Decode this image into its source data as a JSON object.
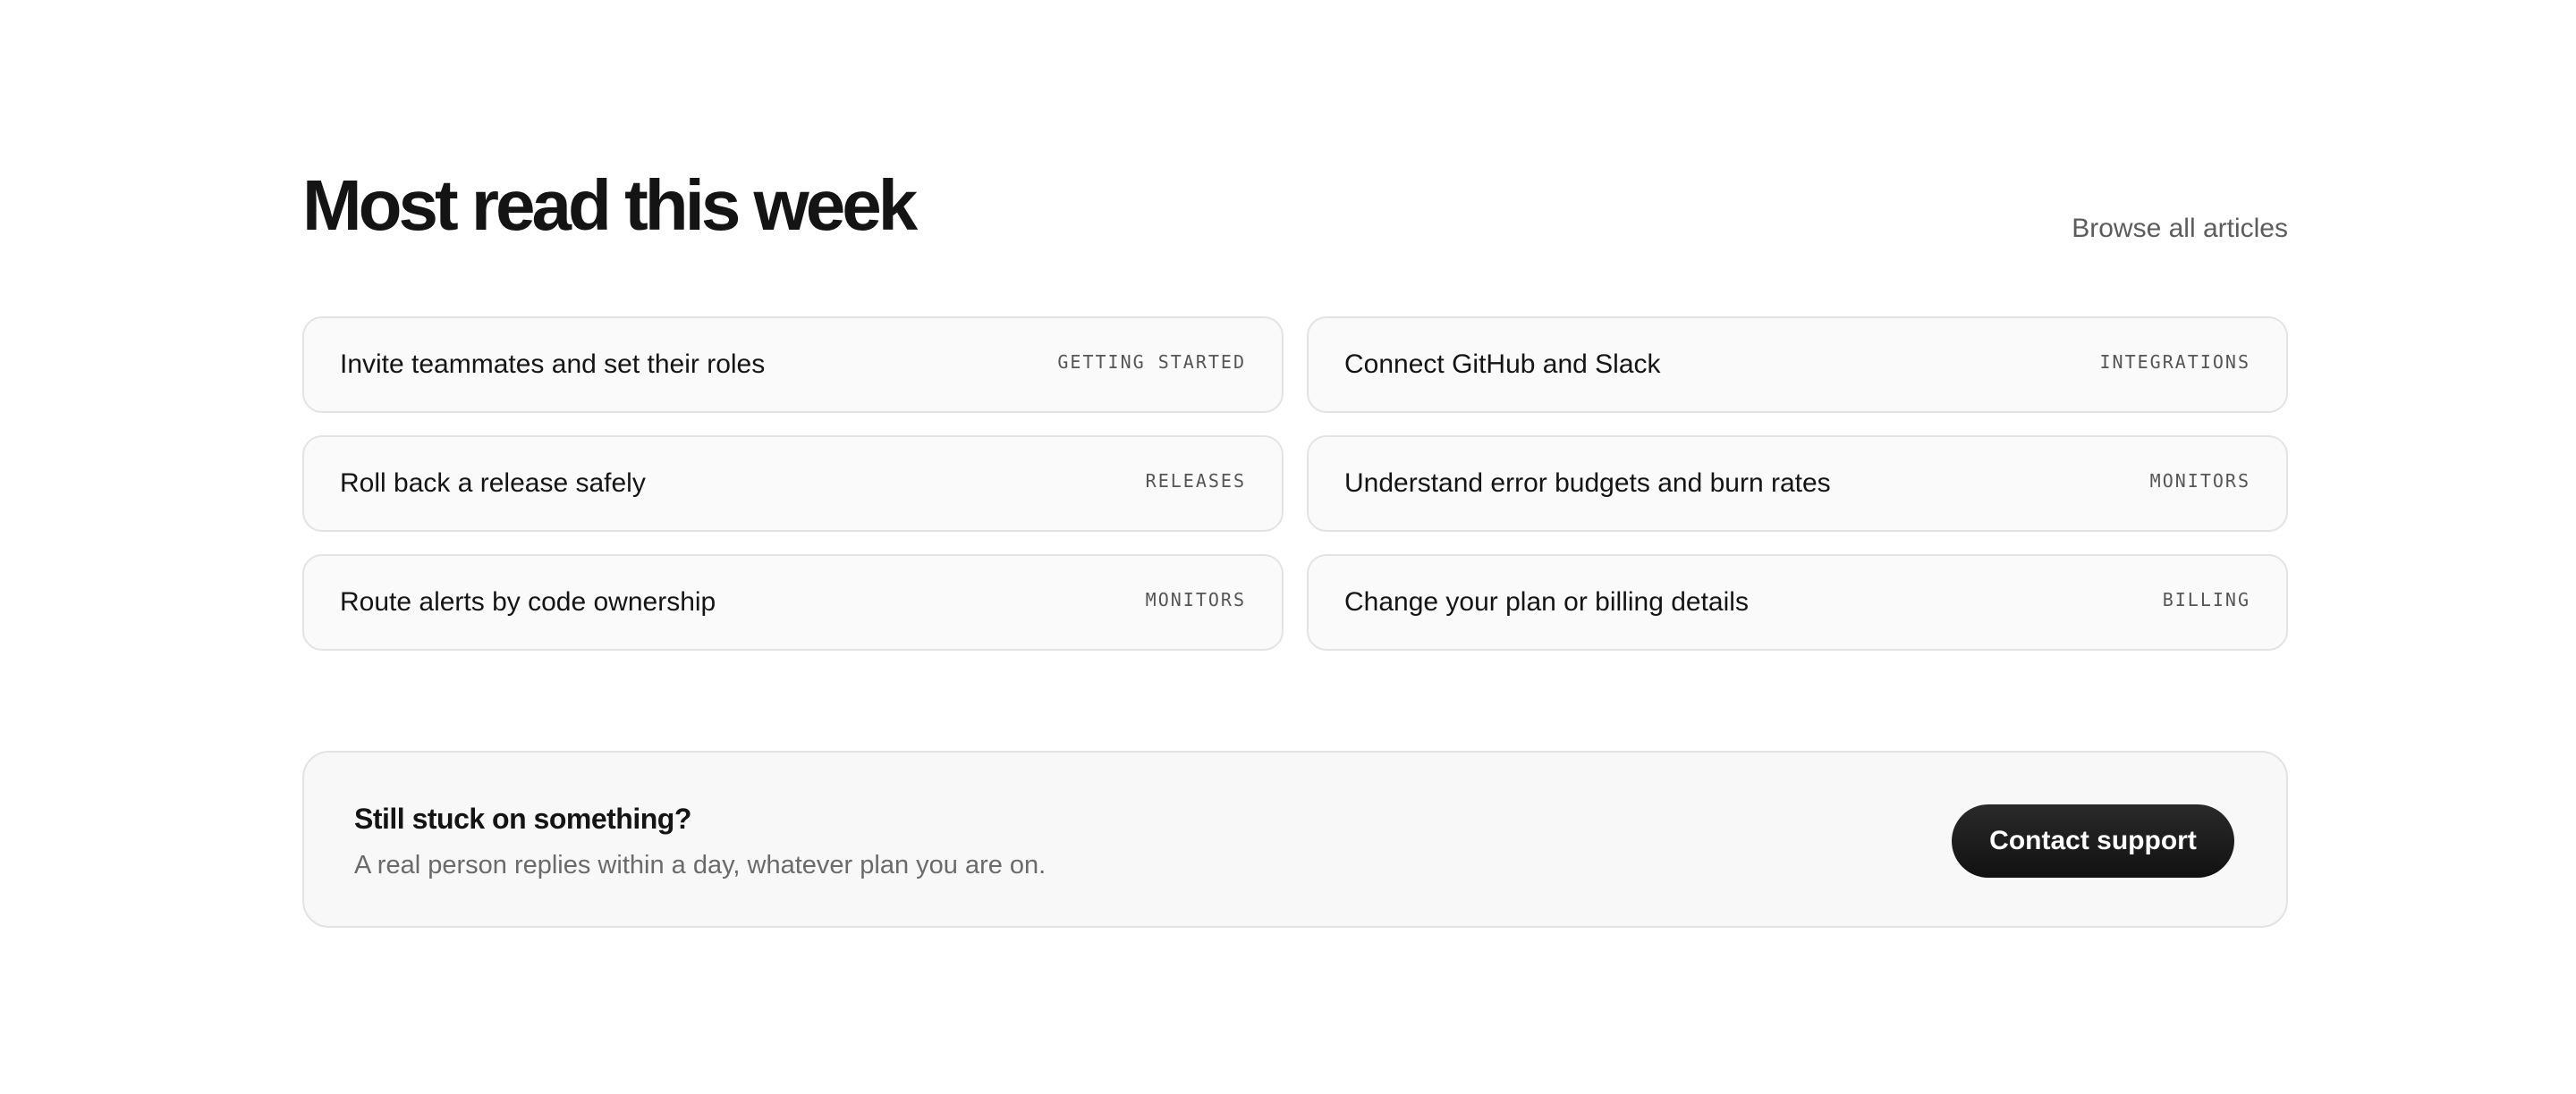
{
  "section": {
    "title": "Most read this week",
    "browse_label": "Browse all articles"
  },
  "articles": [
    {
      "title": "Invite teammates and set their roles",
      "tag": "GETTING STARTED"
    },
    {
      "title": "Connect GitHub and Slack",
      "tag": "INTEGRATIONS"
    },
    {
      "title": "Roll back a release safely",
      "tag": "RELEASES"
    },
    {
      "title": "Understand error budgets and burn rates",
      "tag": "MONITORS"
    },
    {
      "title": "Route alerts by code ownership",
      "tag": "MONITORS"
    },
    {
      "title": "Change your plan or billing details",
      "tag": "BILLING"
    }
  ],
  "support": {
    "title": "Still stuck on something?",
    "text": "A real person replies within a day, whatever plan you are on.",
    "button_label": "Contact support"
  },
  "colors": {
    "heading": "#141414",
    "muted": "#5c5c5c",
    "card_background": "#fafafa",
    "card_border": "#e3e3e3",
    "button_background": "#1a1a1a",
    "button_text": "#ffffff"
  }
}
